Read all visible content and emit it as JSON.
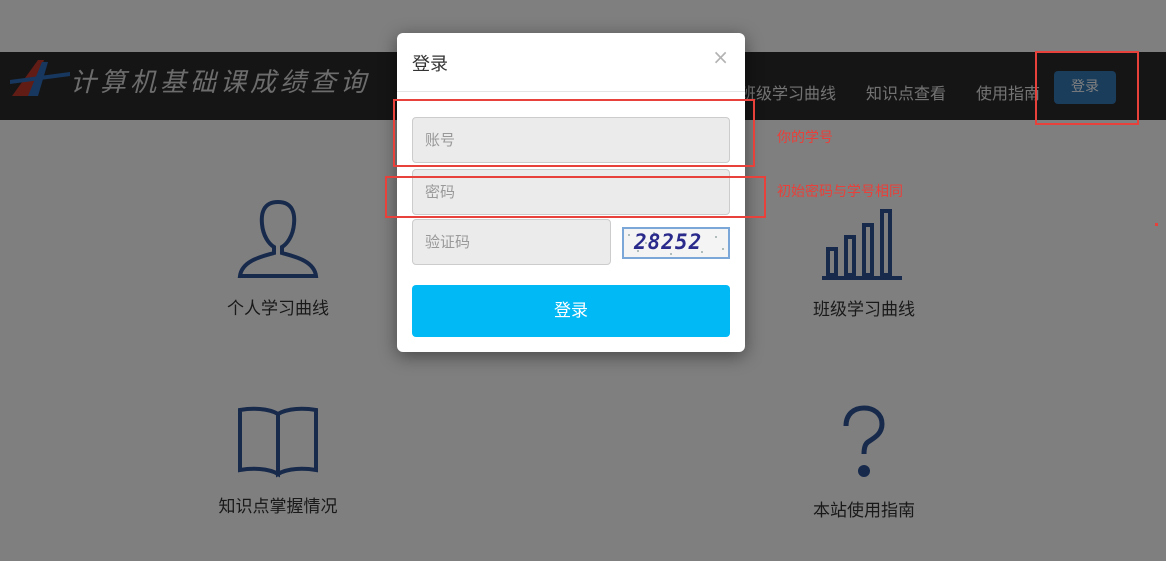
{
  "header": {
    "site_title": "计算机基础课成绩查询",
    "nav": [
      "班级学习曲线",
      "知识点查看",
      "使用指南"
    ],
    "login_button": "登录"
  },
  "features": [
    {
      "label": "个人学习曲线",
      "icon": "user-icon"
    },
    {
      "label": "班级学习曲线",
      "icon": "bar-chart-icon"
    },
    {
      "label": "知识点掌握情况",
      "icon": "book-icon"
    },
    {
      "label": "本站使用指南",
      "icon": "question-icon"
    }
  ],
  "modal": {
    "title": "登录",
    "close": "×",
    "account_placeholder": "账号",
    "password_placeholder": "密码",
    "captcha_placeholder": "验证码",
    "captcha_value": "28252",
    "submit_label": "登录"
  },
  "annotations": {
    "account_note": "你的学号",
    "password_note": "初始密码与学号相同"
  },
  "colors": {
    "annotation": "#e8403a",
    "submit": "#00b9f5",
    "nav_button": "#337ab7",
    "icon": "#2f5597"
  }
}
